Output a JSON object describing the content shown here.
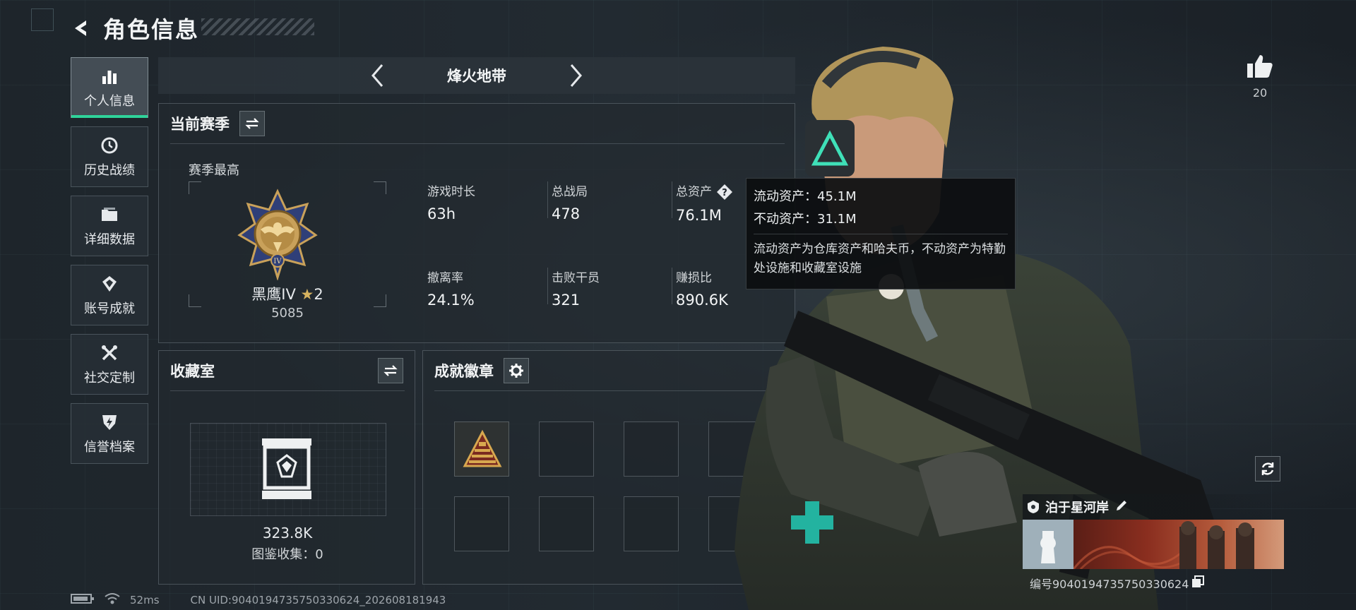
{
  "header": {
    "title": "角色信息"
  },
  "nav": {
    "items": [
      {
        "label": "个人信息",
        "icon": "bar-chart-icon",
        "active": true
      },
      {
        "label": "历史战绩",
        "icon": "history-clock-icon"
      },
      {
        "label": "详细数据",
        "icon": "folder-icon"
      },
      {
        "label": "账号成就",
        "icon": "achievement-icon"
      },
      {
        "label": "社交定制",
        "icon": "tools-icon"
      },
      {
        "label": "信誉档案",
        "icon": "shield-bolt-icon"
      }
    ]
  },
  "mode": {
    "title": "烽火地带"
  },
  "season": {
    "title": "当前赛季",
    "best_label": "赛季最高",
    "rank_name": "黑鹰IV",
    "rank_stars": "2",
    "rank_score": "5085",
    "stats": [
      {
        "label": "游戏时长",
        "value": "63h"
      },
      {
        "label": "总战局",
        "value": "478"
      },
      {
        "label": "总资产",
        "value": "76.1M"
      },
      {
        "label": "撤离率",
        "value": "24.1%"
      },
      {
        "label": "击败干员",
        "value": "321"
      },
      {
        "label": "赚损比",
        "value": "890.6K"
      }
    ]
  },
  "tooltip": {
    "liquid": "流动资产：45.1M",
    "fixed": "不动资产：31.1M",
    "description": "流动资产为仓库资产和哈夫币，不动资产为特勤处设施和收藏室设施"
  },
  "collection": {
    "title": "收藏室",
    "value": "323.8K",
    "count_text": "图鉴收集：0"
  },
  "achievements": {
    "title": "成就徽章"
  },
  "likes": {
    "count": "20"
  },
  "player": {
    "name": "泊于星河岸",
    "id_text": "编号9040194735750330624"
  },
  "status": {
    "ping": "52ms",
    "uid": "CN UID:9040194735750330624_202608181943"
  },
  "colors": {
    "accent": "#2fd39a",
    "star": "#d6b25f"
  }
}
